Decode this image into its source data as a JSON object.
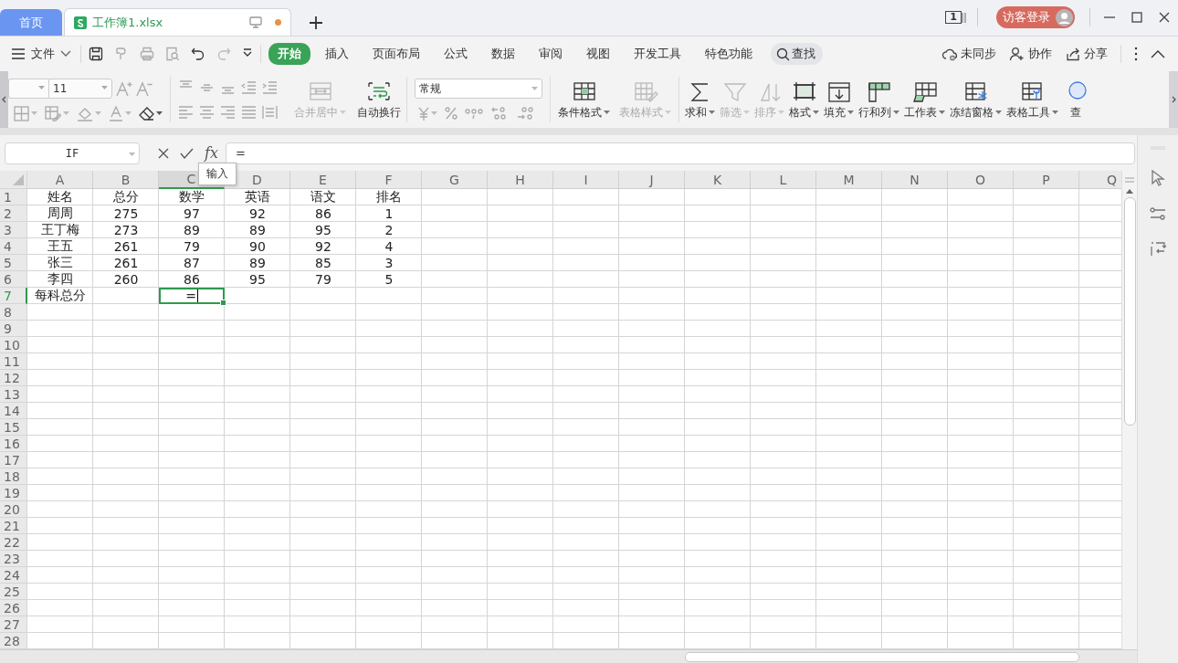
{
  "tabs": [
    {
      "label": "首页",
      "kind": "home",
      "selected": false
    },
    {
      "label": "工作簿1.xlsx",
      "kind": "document",
      "selected": true,
      "unsaved": true
    }
  ],
  "account": {
    "window_count": "1",
    "login": "访客登录"
  },
  "menu": {
    "file": "文件",
    "tabs": [
      {
        "label": "开始",
        "selected": true
      },
      {
        "label": "插入",
        "selected": false
      },
      {
        "label": "页面布局",
        "selected": false
      },
      {
        "label": "公式",
        "selected": false
      },
      {
        "label": "数据",
        "selected": false
      },
      {
        "label": "审阅",
        "selected": false
      },
      {
        "label": "视图",
        "selected": false
      },
      {
        "label": "开发工具",
        "selected": false
      },
      {
        "label": "特色功能",
        "selected": false
      }
    ],
    "search": "查找",
    "actions": [
      {
        "label": "未同步",
        "kind": "sync"
      },
      {
        "label": "协作",
        "kind": "collab"
      },
      {
        "label": "分享",
        "kind": "share"
      }
    ]
  },
  "ribbon": {
    "font_size": "11",
    "number_format": "常规",
    "merge_buttons": [
      {
        "label": "合并居中",
        "kind": "merge",
        "disabled": true,
        "dropdown": true
      },
      {
        "label": "自动换行",
        "kind": "wrap",
        "disabled": false,
        "dropdown": false
      }
    ],
    "style_buttons": [
      {
        "label": "条件格式",
        "kind": "conditional",
        "disabled": false,
        "dropdown": true
      },
      {
        "label": "表格样式",
        "kind": "table-style",
        "disabled": true,
        "dropdown": true
      }
    ],
    "edit_buttons": [
      {
        "label": "求和",
        "kind": "sum",
        "disabled": false,
        "dropdown": true
      },
      {
        "label": "筛选",
        "kind": "filter",
        "disabled": true,
        "dropdown": true
      },
      {
        "label": "排序",
        "kind": "sort",
        "disabled": true,
        "dropdown": true
      },
      {
        "label": "格式",
        "kind": "format",
        "disabled": false,
        "dropdown": true
      },
      {
        "label": "填充",
        "kind": "fill",
        "disabled": false,
        "dropdown": true
      },
      {
        "label": "行和列",
        "kind": "rows-cols",
        "disabled": false,
        "dropdown": true
      },
      {
        "label": "工作表",
        "kind": "worksheet",
        "disabled": false,
        "dropdown": true
      },
      {
        "label": "冻结窗格",
        "kind": "freeze",
        "disabled": false,
        "dropdown": true
      },
      {
        "label": "表格工具",
        "kind": "table-tools",
        "disabled": false,
        "dropdown": true
      },
      {
        "label": "查",
        "kind": "find",
        "disabled": false,
        "dropdown": false
      }
    ]
  },
  "formula_bar": {
    "name_box": "IF",
    "function_button": "fx",
    "formula": "=",
    "tooltip": "输入"
  },
  "sheet": {
    "columns": [
      {
        "label": "A",
        "selected": false
      },
      {
        "label": "B",
        "selected": false
      },
      {
        "label": "C",
        "selected": true
      },
      {
        "label": "D",
        "selected": false
      },
      {
        "label": "E",
        "selected": false
      },
      {
        "label": "F",
        "selected": false
      },
      {
        "label": "G",
        "selected": false
      },
      {
        "label": "H",
        "selected": false
      },
      {
        "label": "I",
        "selected": false
      },
      {
        "label": "J",
        "selected": false
      },
      {
        "label": "K",
        "selected": false
      },
      {
        "label": "L",
        "selected": false
      },
      {
        "label": "M",
        "selected": false
      },
      {
        "label": "N",
        "selected": false
      },
      {
        "label": "O",
        "selected": false
      },
      {
        "label": "P",
        "selected": false
      },
      {
        "label": "Q",
        "selected": false
      }
    ],
    "rows": [
      {
        "label": "1",
        "selected": false,
        "cells": [
          {
            "text": "姓名",
            "active": false
          },
          {
            "text": "总分",
            "active": false
          },
          {
            "text": "数学",
            "active": false
          },
          {
            "text": "英语",
            "active": false
          },
          {
            "text": "语文",
            "active": false
          },
          {
            "text": "排名",
            "active": false
          }
        ]
      },
      {
        "label": "2",
        "selected": false,
        "cells": [
          {
            "text": "周周",
            "active": false
          },
          {
            "text": "275",
            "active": false
          },
          {
            "text": "97",
            "active": false
          },
          {
            "text": "92",
            "active": false
          },
          {
            "text": "86",
            "active": false
          },
          {
            "text": "1",
            "active": false
          }
        ]
      },
      {
        "label": "3",
        "selected": false,
        "cells": [
          {
            "text": "王丁梅",
            "active": false
          },
          {
            "text": "273",
            "active": false
          },
          {
            "text": "89",
            "active": false
          },
          {
            "text": "89",
            "active": false
          },
          {
            "text": "95",
            "active": false
          },
          {
            "text": "2",
            "active": false
          }
        ]
      },
      {
        "label": "4",
        "selected": false,
        "cells": [
          {
            "text": "王五",
            "active": false
          },
          {
            "text": "261",
            "active": false
          },
          {
            "text": "79",
            "active": false
          },
          {
            "text": "90",
            "active": false
          },
          {
            "text": "92",
            "active": false
          },
          {
            "text": "4",
            "active": false
          }
        ]
      },
      {
        "label": "5",
        "selected": false,
        "cells": [
          {
            "text": "张三",
            "active": false
          },
          {
            "text": "261",
            "active": false
          },
          {
            "text": "87",
            "active": false
          },
          {
            "text": "89",
            "active": false
          },
          {
            "text": "85",
            "active": false
          },
          {
            "text": "3",
            "active": false
          }
        ]
      },
      {
        "label": "6",
        "selected": false,
        "cells": [
          {
            "text": "李四",
            "active": false
          },
          {
            "text": "260",
            "active": false
          },
          {
            "text": "86",
            "active": false
          },
          {
            "text": "95",
            "active": false
          },
          {
            "text": "79",
            "active": false
          },
          {
            "text": "5",
            "active": false
          }
        ]
      },
      {
        "label": "7",
        "selected": true,
        "cells": [
          {
            "text": "每科总分",
            "active": false
          },
          null,
          {
            "text": "=",
            "active": true
          }
        ]
      },
      {
        "label": "8",
        "selected": false
      },
      {
        "label": "9",
        "selected": false
      },
      {
        "label": "10",
        "selected": false
      },
      {
        "label": "11",
        "selected": false
      },
      {
        "label": "12",
        "selected": false
      },
      {
        "label": "13",
        "selected": false
      },
      {
        "label": "14",
        "selected": false
      },
      {
        "label": "15",
        "selected": false
      },
      {
        "label": "16",
        "selected": false
      },
      {
        "label": "17",
        "selected": false
      },
      {
        "label": "18",
        "selected": false
      },
      {
        "label": "19",
        "selected": false
      },
      {
        "label": "20",
        "selected": false
      },
      {
        "label": "21",
        "selected": false
      },
      {
        "label": "22",
        "selected": false
      },
      {
        "label": "23",
        "selected": false
      },
      {
        "label": "24",
        "selected": false
      },
      {
        "label": "25",
        "selected": false
      },
      {
        "label": "26",
        "selected": false
      },
      {
        "label": "27",
        "selected": false
      },
      {
        "label": "28",
        "selected": false
      }
    ]
  }
}
